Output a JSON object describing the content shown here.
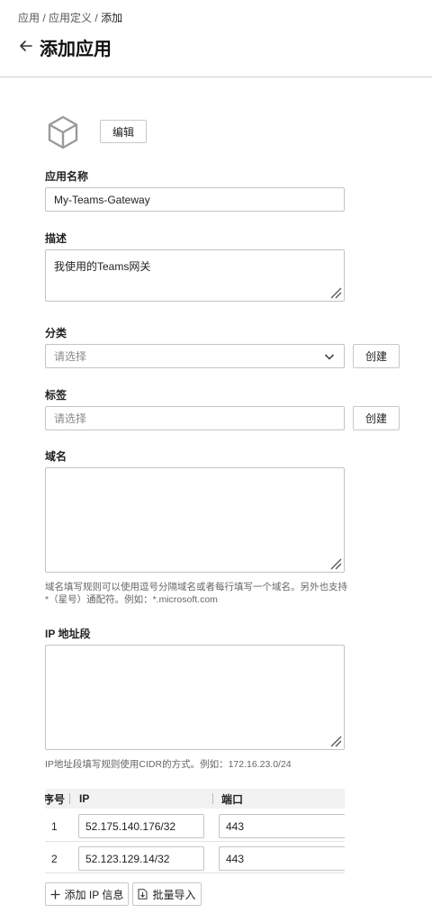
{
  "breadcrumb": {
    "item1": "应用",
    "sep1": " / ",
    "item2": "应用定义",
    "sep2": " / ",
    "current": "添加"
  },
  "header": {
    "title": "添加应用"
  },
  "logo": {
    "icon": "cube-icon",
    "edit_label": "编辑"
  },
  "form": {
    "name": {
      "label": "应用名称",
      "value": "My-Teams-Gateway"
    },
    "description": {
      "label": "描述",
      "value": "我使用的Teams网关"
    },
    "category": {
      "label": "分类",
      "placeholder": "请选择",
      "create_label": "创建"
    },
    "tags": {
      "label": "标签",
      "placeholder": "请选择",
      "create_label": "创建"
    },
    "domains": {
      "label": "域名",
      "value": "",
      "help": "域名填写规则可以使用逗号分隔域名或者每行填写一个域名。另外也支持*（星号）通配符。例如：*.microsoft.com"
    },
    "ip_ranges": {
      "label": "IP 地址段",
      "value": "",
      "help": "IP地址段填写规则使用CIDR的方式。例如：172.16.23.0/24"
    }
  },
  "ip_table": {
    "headers": {
      "index": "序号",
      "ip": "IP",
      "port": "端口"
    },
    "rows": [
      {
        "index": "1",
        "ip": "52.175.140.176/32",
        "port": "443"
      },
      {
        "index": "2",
        "ip": "52.123.129.14/32",
        "port": "443"
      }
    ],
    "add_label": "添加 IP 信息",
    "import_label": "批量导入"
  }
}
